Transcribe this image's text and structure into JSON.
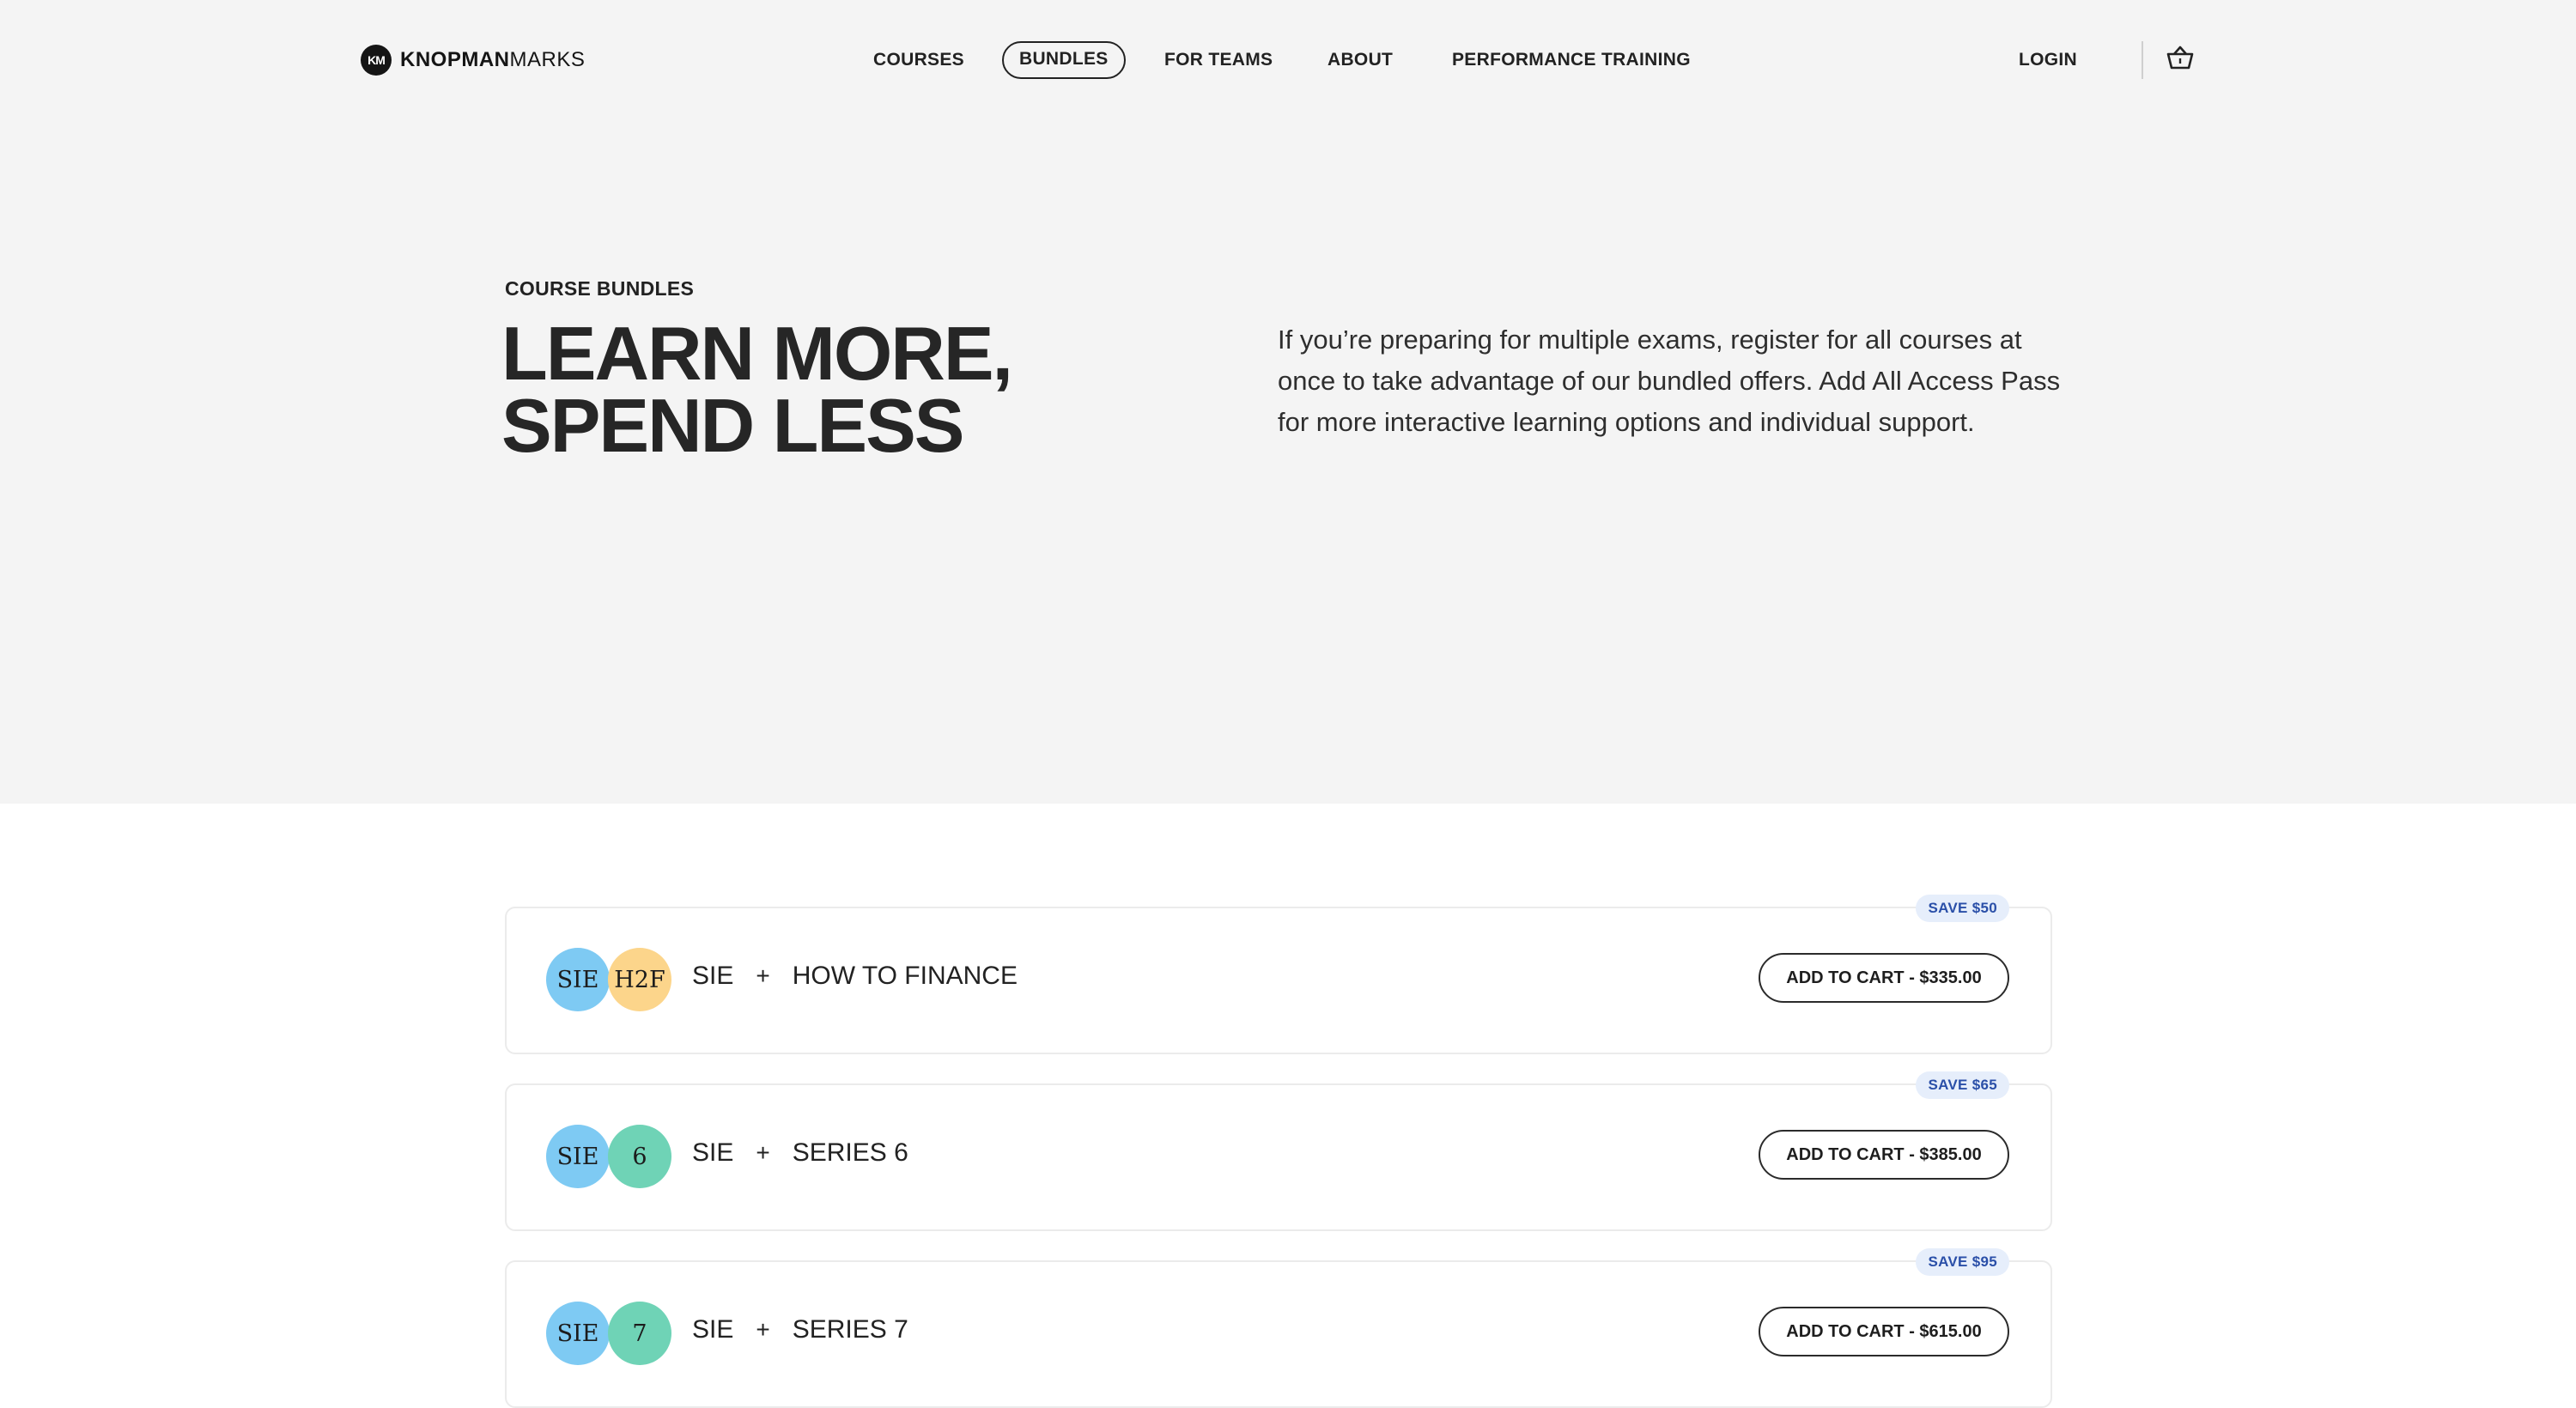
{
  "header": {
    "logo_mark": "KM",
    "logo_bold": "KNOPMAN",
    "logo_light": "MARKS",
    "nav": [
      "COURSES",
      "BUNDLES",
      "FOR TEAMS",
      "ABOUT",
      "PERFORMANCE TRAINING"
    ],
    "active_nav": "BUNDLES",
    "login": "LOGIN",
    "cart_icon": "basket-icon"
  },
  "hero": {
    "eyebrow": "COURSE BUNDLES",
    "headline_line1": "LEARN MORE,",
    "headline_line2": "SPEND LESS",
    "intro": "If you’re preparing for multiple exams, register for all courses at once to take advantage of our bundled offers. Add All Access Pass for more interactive learning options and individual support."
  },
  "colors": {
    "blue_badge": "#7ecaf3",
    "yellow_badge": "#fcd58b",
    "green_badge": "#6fd3b6",
    "save_badge_bg": "#e6eefb",
    "save_badge_text": "#2a4fa8",
    "hero_bg": "#f4f4f4"
  },
  "bundles": [
    {
      "save": "SAVE $50",
      "badge1": "SIE",
      "badge1_color": "#7ecaf3",
      "badge2": "H2F",
      "badge2_color": "#fcd58b",
      "course1": "SIE",
      "plus": "+",
      "course2": "HOW TO FINANCE",
      "button": "ADD TO CART - $335.00"
    },
    {
      "save": "SAVE $65",
      "badge1": "SIE",
      "badge1_color": "#7ecaf3",
      "badge2": "6",
      "badge2_color": "#6fd3b6",
      "course1": "SIE",
      "plus": "+",
      "course2": "SERIES 6",
      "button": "ADD TO CART - $385.00"
    },
    {
      "save": "SAVE $95",
      "badge1": "SIE",
      "badge1_color": "#7ecaf3",
      "badge2": "7",
      "badge2_color": "#6fd3b6",
      "course1": "SIE",
      "plus": "+",
      "course2": "SERIES 7",
      "button": "ADD TO CART - $615.00"
    }
  ]
}
